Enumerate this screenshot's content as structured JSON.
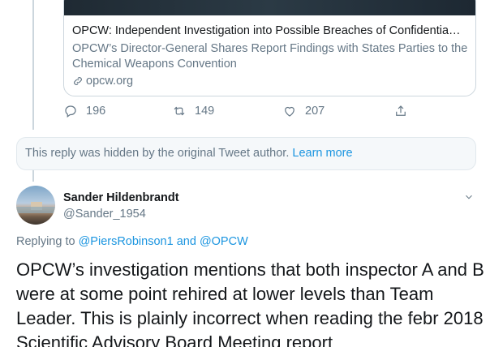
{
  "link_card": {
    "title": "OPCW: Independent Investigation into Possible Breaches of Confidentia…",
    "description": "OPCW’s Director-General Shares Report Findings with States Parties to the Chemical Weapons Convention",
    "domain": "opcw.org"
  },
  "actions": {
    "replies": "196",
    "retweets": "149",
    "likes": "207"
  },
  "hidden_notice": {
    "text": "This reply was hidden by the original Tweet author.",
    "link": "Learn more"
  },
  "reply_tweet": {
    "author_name": "Sander Hildenbrandt",
    "author_handle": "@Sander_1954",
    "replying_prefix": "Replying to",
    "replying_to_1": "@PiersRobinson1",
    "replying_and": "and",
    "replying_to_2": "@OPCW",
    "text": "OPCW’s investigation mentions that both inspector A and B were at some point rehired at lower levels than Team Leader. This is plainly incorrect when reading the febr 2018 Scientific Advisory Board Meeting report"
  },
  "colors": {
    "accent": "#1b95e0",
    "muted": "#657786",
    "border": "#ccd6dd"
  },
  "icons": [
    "reply-icon",
    "retweet-icon",
    "like-icon",
    "share-icon",
    "link-icon",
    "chevron-down-icon"
  ]
}
